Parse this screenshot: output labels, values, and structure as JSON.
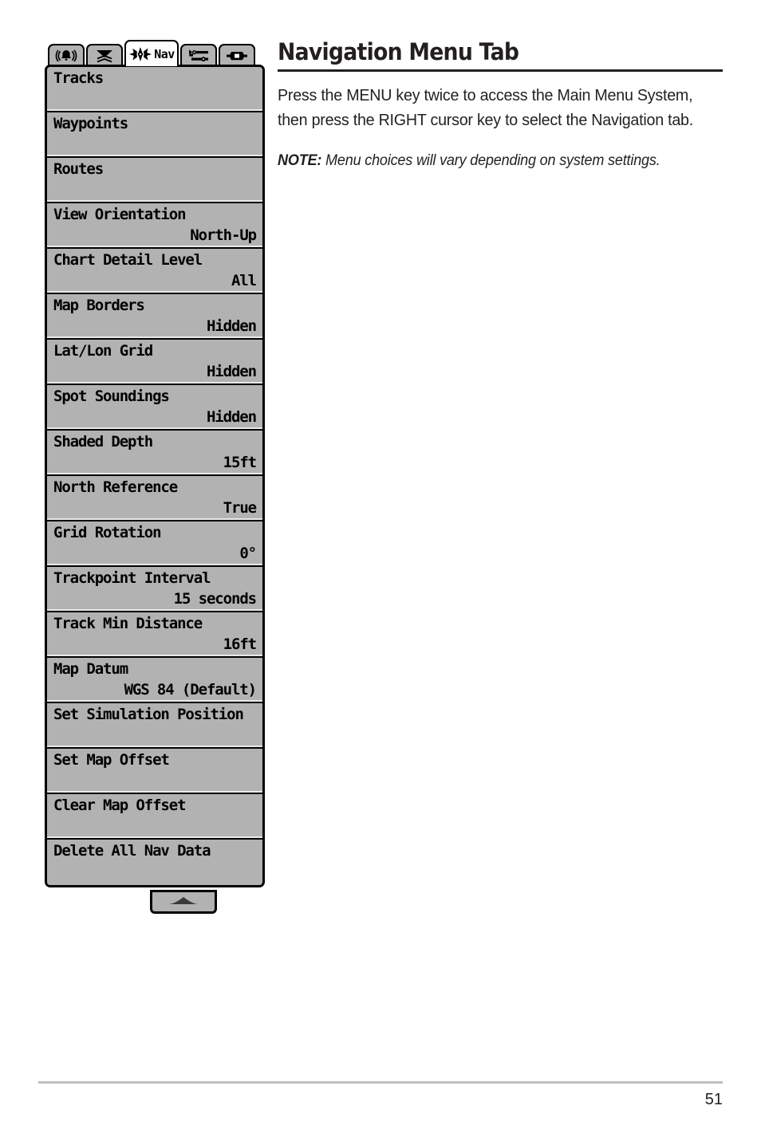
{
  "page": {
    "title": "Navigation Menu Tab",
    "intro": "Press the MENU key twice to access the Main Menu System, then press the RIGHT cursor key to select the Navigation tab.",
    "note_label": "NOTE:",
    "note_text": "Menu choices will vary depending on system settings.",
    "page_number": "51"
  },
  "lcd": {
    "tabs": [
      {
        "icon": "alarm-bell-icon",
        "label": "",
        "selected": false
      },
      {
        "icon": "sonar-cone-icon",
        "label": "",
        "selected": false
      },
      {
        "icon": "nav-compass-icon",
        "label": "Nav",
        "selected": true
      },
      {
        "icon": "setup-wrench-icon",
        "label": "",
        "selected": false
      },
      {
        "icon": "views-display-icon",
        "label": "",
        "selected": false
      }
    ],
    "scroll_indicator_icon": "scroll-up-arrow-icon",
    "menu_items": [
      {
        "label": "Tracks",
        "value": ""
      },
      {
        "label": "Waypoints",
        "value": ""
      },
      {
        "label": "Routes",
        "value": ""
      },
      {
        "label": "View Orientation",
        "value": "North-Up"
      },
      {
        "label": "Chart Detail Level",
        "value": "All"
      },
      {
        "label": "Map Borders",
        "value": "Hidden"
      },
      {
        "label": "Lat/Lon Grid",
        "value": "Hidden"
      },
      {
        "label": "Spot Soundings",
        "value": "Hidden"
      },
      {
        "label": "Shaded Depth",
        "value": "15ft"
      },
      {
        "label": "North Reference",
        "value": "True"
      },
      {
        "label": "Grid Rotation",
        "value": "0°"
      },
      {
        "label": "Trackpoint Interval",
        "value": "15 seconds"
      },
      {
        "label": "Track Min Distance",
        "value": "16ft"
      },
      {
        "label": "Map Datum",
        "value": "WGS 84 (Default)"
      },
      {
        "label": "Set Simulation Position",
        "value": ""
      },
      {
        "label": "Set Map Offset",
        "value": ""
      },
      {
        "label": "Clear Map Offset",
        "value": ""
      },
      {
        "label": "Delete All Nav Data",
        "value": ""
      }
    ]
  },
  "colors": {
    "lcd_background": "#b2b2b2",
    "lcd_border": "#000000",
    "selected_tab": "#ffffff",
    "text": "#231f20",
    "footer_rule": "#bcbec0"
  }
}
